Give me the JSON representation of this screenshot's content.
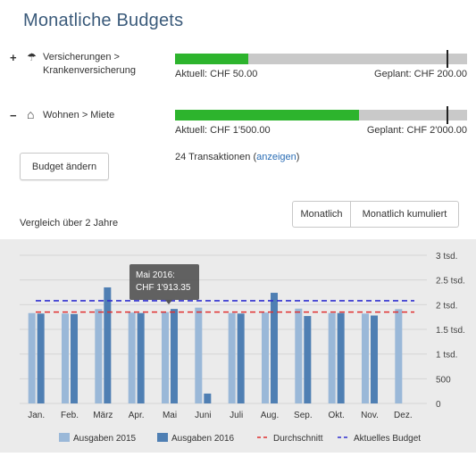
{
  "page": {
    "title": "Monatliche Budgets"
  },
  "budgets": [
    {
      "toggle": "+",
      "icon": "umbrella-icon",
      "icon_glyph": "☂",
      "label_line1": "Versicherungen >",
      "label_line2": "Krankenversicherung",
      "current": "Aktuell: CHF 50.00",
      "planned": "Geplant: CHF 200.00",
      "fill_fraction": 0.25,
      "planned_marker_fraction": 0.93
    },
    {
      "toggle": "−",
      "icon": "home-icon",
      "icon_glyph": "⌂",
      "label_line1": "Wohnen > Miete",
      "label_line2": "",
      "current": "Aktuell: CHF 1'500.00",
      "planned": "Geplant: CHF 2'000.00",
      "fill_fraction": 0.63,
      "planned_marker_fraction": 0.93
    }
  ],
  "actions": {
    "edit_budget": "Budget ändern",
    "transactions_count": "24 Transaktionen (",
    "transactions_link": "anzeigen",
    "transactions_close": ")"
  },
  "comparison": {
    "label": "Vergleich über 2 Jahre",
    "buttons": [
      "Monatlich",
      "Monatlich kumuliert"
    ]
  },
  "tooltip": {
    "line1": "Mai 2016:",
    "line2": "CHF 1'913.35"
  },
  "colors": {
    "series_2015": "#9ab8d8",
    "series_2016": "#4f7fb3",
    "average": "#e03030",
    "current_budget": "#3030d0",
    "positive_bar": "#2db42d"
  },
  "chart_data": {
    "type": "bar",
    "categories": [
      "Jan.",
      "Feb.",
      "März",
      "Apr.",
      "Mai",
      "Juni",
      "Juli",
      "Aug.",
      "Sep.",
      "Okt.",
      "Nov.",
      "Dez."
    ],
    "series": [
      {
        "name": "Ausgaben 2015",
        "values": [
          1830,
          1820,
          1910,
          1840,
          1850,
          1940,
          1830,
          1840,
          1920,
          1830,
          1820,
          1910
        ]
      },
      {
        "name": "Ausgaben 2016",
        "values": [
          1820,
          1810,
          2350,
          1830,
          1913.35,
          200,
          1820,
          2240,
          1770,
          1830,
          1780,
          null
        ]
      }
    ],
    "lines": [
      {
        "name": "Durchschnitt",
        "value": 1850,
        "style": "dashed"
      },
      {
        "name": "Aktuelles Budget",
        "value": 2080,
        "style": "dashed"
      }
    ],
    "ylim": [
      0,
      3000
    ],
    "yticks": [
      0,
      500,
      1000,
      1500,
      2000,
      2500,
      3000
    ],
    "ytick_labels": [
      "0",
      "500",
      "1 tsd.",
      "1.5 tsd.",
      "2 tsd.",
      "2.5 tsd.",
      "3 tsd."
    ],
    "legend_position": "bottom",
    "grid": true
  }
}
